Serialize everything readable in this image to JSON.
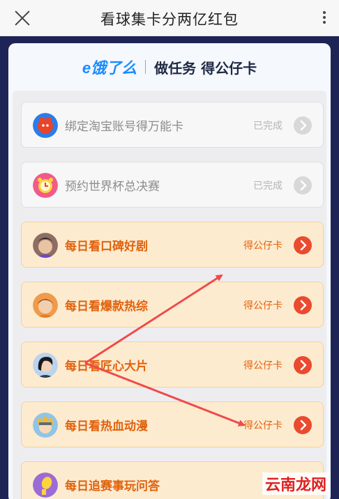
{
  "window": {
    "title": "看球集卡分两亿红包"
  },
  "brand": {
    "logo": "e饿了么",
    "heading": "做任务 得公仔卡"
  },
  "tasks": [
    {
      "label": "绑定淘宝账号得万能卡",
      "status": "已完成",
      "state": "done",
      "icon": "taobao-avatar-icon"
    },
    {
      "label": "预约世界杯总决赛",
      "status": "已完成",
      "state": "done",
      "icon": "alarm-clock-icon"
    },
    {
      "label": "每日看口碑好剧",
      "status": "得公仔卡",
      "state": "todo",
      "icon": "actor-avatar-icon"
    },
    {
      "label": "每日看爆款热综",
      "status": "得公仔卡",
      "state": "todo",
      "icon": "celebrity-avatar-icon"
    },
    {
      "label": "每日看匠心大片",
      "status": "得公仔卡",
      "state": "todo",
      "icon": "actress-avatar-icon"
    },
    {
      "label": "每日看热血动漫",
      "status": "得公仔卡",
      "state": "todo",
      "icon": "anime-avatar-icon"
    },
    {
      "label": "每日追赛事玩问答",
      "status": "",
      "state": "todo",
      "icon": "trophy-avatar-icon"
    }
  ],
  "watermark": "云南龙网",
  "colors": {
    "accent": "#ea4a2e",
    "todo_text": "#e0620d",
    "todo_bg": "#fdebd0",
    "page_bg": "#1e2455"
  }
}
